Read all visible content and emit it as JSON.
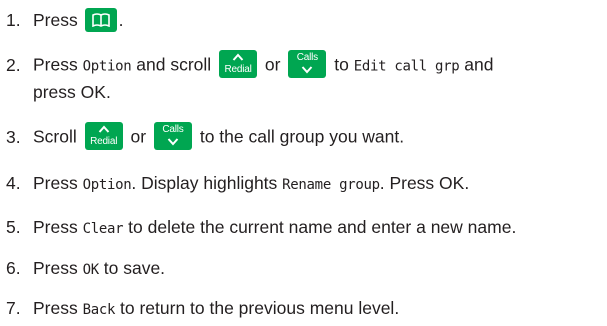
{
  "steps": [
    {
      "num": "1.",
      "before": "Press",
      "after": ".",
      "phonebook_key_icon": "phonebook-book-icon"
    },
    {
      "num": "2.",
      "press": "Press",
      "option_lcd": "Option",
      "and_scroll": "and scroll",
      "redial_label": "Redial",
      "or": "or",
      "calls_label": "Calls",
      "to": "to",
      "edit_lcd": "Edit call grp",
      "and": "and",
      "line2": "press OK."
    },
    {
      "num": "3.",
      "scroll": "Scroll",
      "redial_label": "Redial",
      "or": "or",
      "calls_label": "Calls",
      "after": "to the call group you want."
    },
    {
      "num": "4.",
      "press": "Press",
      "option_lcd": "Option",
      "display_highlights": ". Display highlights",
      "rename_lcd": "Rename group",
      "press_ok": ". Press OK."
    },
    {
      "num": "5.",
      "press": "Press",
      "clear_lcd": "Clear",
      "after": "to delete the current name and enter a new name."
    },
    {
      "num": "6.",
      "press": "Press",
      "ok_lcd": "OK",
      "after": "to save."
    },
    {
      "num": "7.",
      "press": "Press",
      "back_lcd": "Back",
      "after": "to return to the previous menu level."
    }
  ],
  "colors": {
    "key_green": "#00a651",
    "text": "#231f20"
  }
}
